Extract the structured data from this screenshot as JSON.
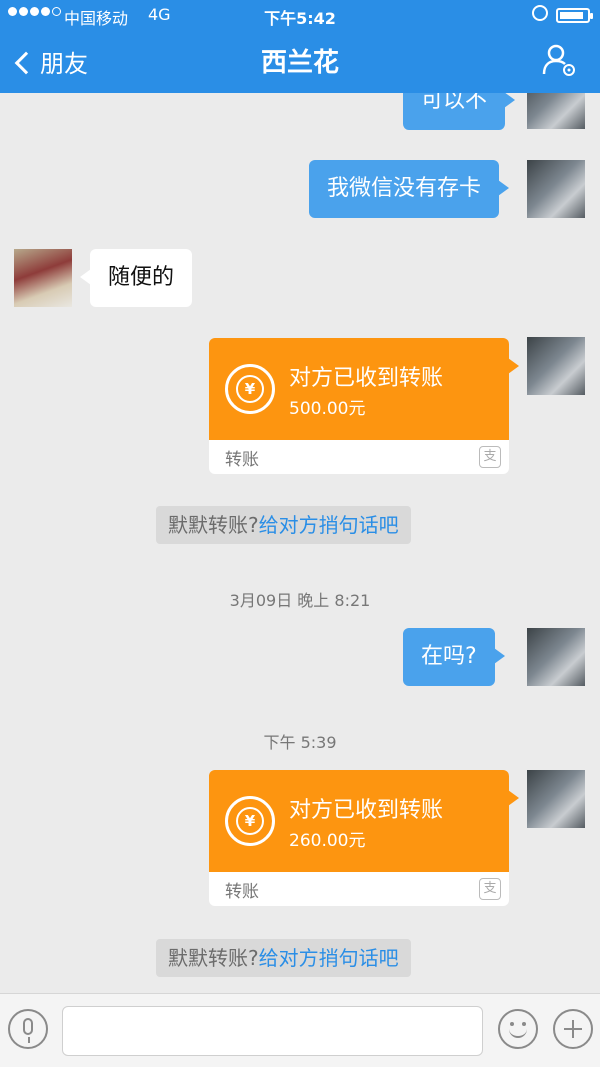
{
  "status_bar": {
    "carrier": "中国移动",
    "network": "4G",
    "time": "下午5:42",
    "battery_level": 0.9
  },
  "nav": {
    "back_label": "朋友",
    "title": "西兰花"
  },
  "messages": [
    {
      "from": "me",
      "type": "text",
      "text": "可以不"
    },
    {
      "from": "me",
      "type": "text",
      "text": "我微信没有存卡"
    },
    {
      "from": "friend",
      "type": "text",
      "text": "随便的"
    },
    {
      "from": "me",
      "type": "transfer",
      "coin_symbol": "¥",
      "status": "对方已收到转账",
      "amount": "500.00元",
      "kind": "转账",
      "logo": "支"
    },
    {
      "type": "system",
      "prefix": "默默转账?",
      "link": "给对方捎句话吧"
    },
    {
      "type": "timestamp",
      "text": "3月09日 晚上 8:21"
    },
    {
      "from": "me",
      "type": "text",
      "text": "在吗?"
    },
    {
      "type": "timestamp",
      "text": "下午 5:39"
    },
    {
      "from": "me",
      "type": "transfer",
      "coin_symbol": "¥",
      "status": "对方已收到转账",
      "amount": "260.00元",
      "kind": "转账",
      "logo": "支"
    },
    {
      "type": "system",
      "prefix": "默默转账?",
      "link": "给对方捎句话吧"
    }
  ],
  "input_bar": {
    "icons": [
      "microphone-icon",
      "emoji-icon",
      "plus-icon"
    ],
    "text": ""
  },
  "colors": {
    "nav_blue": "#2a8ee6",
    "my_bubble": "#4aa2ec",
    "transfer_orange": "#fd9510",
    "background": "#ebebeb"
  }
}
